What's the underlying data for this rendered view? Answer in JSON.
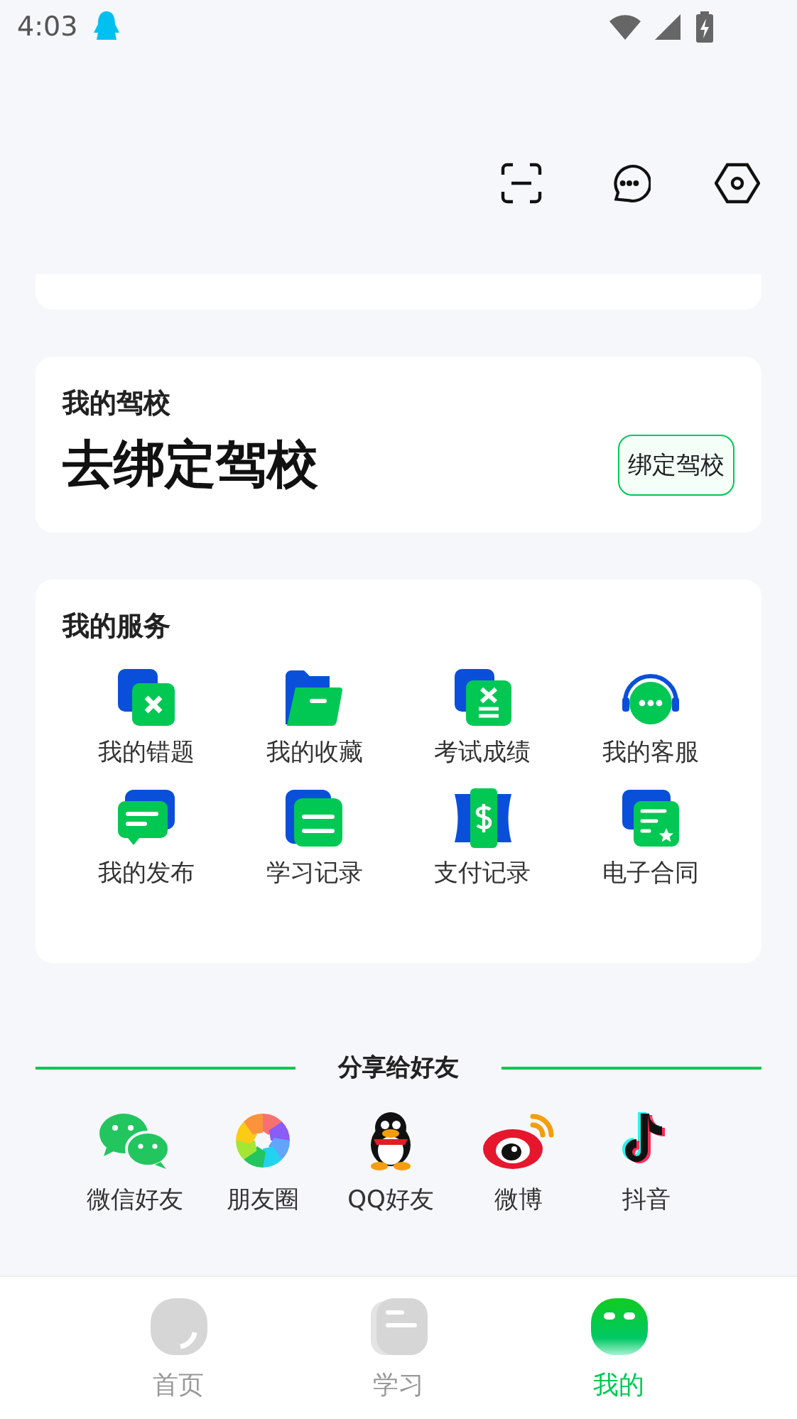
{
  "status_bar": {
    "time": "4:03"
  },
  "driving_school": {
    "label": "我的驾校",
    "headline": "去绑定驾校",
    "button": "绑定驾校"
  },
  "services": {
    "title": "我的服务",
    "items": [
      {
        "label": "我的错题",
        "kind": "wrong"
      },
      {
        "label": "我的收藏",
        "kind": "folder"
      },
      {
        "label": "考试成绩",
        "kind": "score"
      },
      {
        "label": "我的客服",
        "kind": "support"
      },
      {
        "label": "我的发布",
        "kind": "post"
      },
      {
        "label": "学习记录",
        "kind": "record"
      },
      {
        "label": "支付记录",
        "kind": "pay"
      },
      {
        "label": "电子合同",
        "kind": "contract"
      }
    ]
  },
  "share": {
    "title": "分享给好友",
    "items": [
      {
        "label": "微信好友",
        "kind": "chat"
      },
      {
        "label": "朋友圈",
        "kind": "shutter"
      },
      {
        "label": "QQ好友",
        "kind": "penguin"
      },
      {
        "label": "微博",
        "kind": "eye"
      },
      {
        "label": "抖音",
        "kind": "note"
      }
    ]
  },
  "tab_bar": [
    {
      "label": "首页",
      "selected": false,
      "kind": "home"
    },
    {
      "label": "学习",
      "selected": false,
      "kind": "study"
    },
    {
      "label": "我的",
      "selected": true,
      "kind": "me"
    }
  ]
}
